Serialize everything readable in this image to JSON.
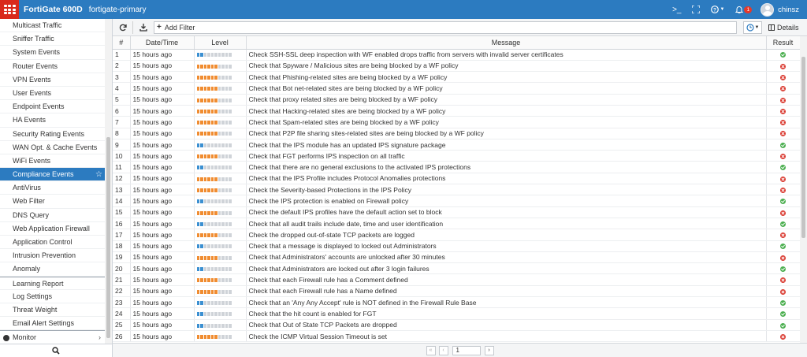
{
  "header": {
    "product": "FortiGate 600D",
    "hostname": "fortigate-primary",
    "cli_icon": ">_",
    "notification_count": "1",
    "username": "chinsz"
  },
  "sidebar": {
    "items": [
      {
        "label": "Multicast Traffic"
      },
      {
        "label": "Sniffer Traffic"
      },
      {
        "label": "System Events"
      },
      {
        "label": "Router Events"
      },
      {
        "label": "VPN Events"
      },
      {
        "label": "User Events"
      },
      {
        "label": "Endpoint Events"
      },
      {
        "label": "HA Events"
      },
      {
        "label": "Security Rating Events"
      },
      {
        "label": "WAN Opt. & Cache Events"
      },
      {
        "label": "WiFi Events"
      },
      {
        "label": "Compliance Events"
      },
      {
        "label": "AntiVirus"
      },
      {
        "label": "Web Filter"
      },
      {
        "label": "DNS Query"
      },
      {
        "label": "Web Application Firewall"
      },
      {
        "label": "Application Control"
      },
      {
        "label": "Intrusion Prevention"
      },
      {
        "label": "Anomaly"
      },
      {
        "label": "Learning Report"
      },
      {
        "label": "Log Settings"
      },
      {
        "label": "Threat Weight"
      },
      {
        "label": "Email Alert Settings"
      },
      {
        "label": "Monitor"
      }
    ],
    "active_index": 11
  },
  "toolbar": {
    "add_filter_label": "Add Filter",
    "details_label": "Details"
  },
  "table": {
    "columns": [
      "#",
      "Date/Time",
      "Level",
      "Message",
      "Result"
    ],
    "rows": [
      {
        "num": "1",
        "time": "15 hours ago",
        "level": 2,
        "msg": "Check SSH-SSL deep inspection with WF enabled drops traffic from servers with invalid server certificates",
        "result": "pass"
      },
      {
        "num": "2",
        "time": "15 hours ago",
        "level": 6,
        "msg": "Check that Spyware / Malicious sites are being blocked by a WF policy",
        "result": "fail"
      },
      {
        "num": "3",
        "time": "15 hours ago",
        "level": 6,
        "msg": "Check that Phishing-related sites are being blocked by a WF policy",
        "result": "fail"
      },
      {
        "num": "4",
        "time": "15 hours ago",
        "level": 6,
        "msg": "Check that Bot net-related sites are being blocked by a WF policy",
        "result": "fail"
      },
      {
        "num": "5",
        "time": "15 hours ago",
        "level": 6,
        "msg": "Check that proxy related sites are being blocked by a WF policy",
        "result": "fail"
      },
      {
        "num": "6",
        "time": "15 hours ago",
        "level": 6,
        "msg": "Check that Hacking-related sites are being blocked by a WF policy",
        "result": "fail"
      },
      {
        "num": "7",
        "time": "15 hours ago",
        "level": 6,
        "msg": "Check that Spam-related sites are being blocked by a WF policy",
        "result": "fail"
      },
      {
        "num": "8",
        "time": "15 hours ago",
        "level": 6,
        "msg": "Check that P2P file sharing sites-related sites are being blocked by a WF policy",
        "result": "fail"
      },
      {
        "num": "9",
        "time": "15 hours ago",
        "level": 2,
        "msg": "Check that the IPS module has an updated IPS signature package",
        "result": "pass"
      },
      {
        "num": "10",
        "time": "15 hours ago",
        "level": 6,
        "msg": "Check that FGT performs IPS inspection on all traffic",
        "result": "fail"
      },
      {
        "num": "11",
        "time": "15 hours ago",
        "level": 2,
        "msg": "Check that there are no general exclusions to the activated IPS protections",
        "result": "pass"
      },
      {
        "num": "12",
        "time": "15 hours ago",
        "level": 6,
        "msg": "Check that the IPS Profile includes Protocol Anomalies protections",
        "result": "fail"
      },
      {
        "num": "13",
        "time": "15 hours ago",
        "level": 6,
        "msg": "Check the Severity-based Protections in the IPS Policy",
        "result": "fail"
      },
      {
        "num": "14",
        "time": "15 hours ago",
        "level": 2,
        "msg": "Check the IPS protection is enabled on Firewall policy",
        "result": "pass"
      },
      {
        "num": "15",
        "time": "15 hours ago",
        "level": 6,
        "msg": "Check the default IPS profiles have the default action set to block",
        "result": "fail"
      },
      {
        "num": "16",
        "time": "15 hours ago",
        "level": 2,
        "msg": "Check that all audit trails include date, time and user identification",
        "result": "pass"
      },
      {
        "num": "17",
        "time": "15 hours ago",
        "level": 6,
        "msg": "Check the dropped out-of-state TCP packets are logged",
        "result": "fail"
      },
      {
        "num": "18",
        "time": "15 hours ago",
        "level": 2,
        "msg": "Check that a message is displayed to locked out Administrators",
        "result": "pass"
      },
      {
        "num": "19",
        "time": "15 hours ago",
        "level": 6,
        "msg": "Check that Administrators' accounts are unlocked after 30 minutes",
        "result": "fail"
      },
      {
        "num": "20",
        "time": "15 hours ago",
        "level": 2,
        "msg": "Check that Administrators are locked out after 3 login failures",
        "result": "pass"
      },
      {
        "num": "21",
        "time": "15 hours ago",
        "level": 6,
        "msg": "Check that each Firewall rule has a Comment defined",
        "result": "fail"
      },
      {
        "num": "22",
        "time": "15 hours ago",
        "level": 6,
        "msg": "Check that each Firewall rule has a Name defined",
        "result": "fail"
      },
      {
        "num": "23",
        "time": "15 hours ago",
        "level": 2,
        "msg": "Check that an 'Any Any Accept' rule is NOT defined in the Firewall Rule Base",
        "result": "pass"
      },
      {
        "num": "24",
        "time": "15 hours ago",
        "level": 2,
        "msg": "Check that the hit count is enabled for FGT",
        "result": "pass"
      },
      {
        "num": "25",
        "time": "15 hours ago",
        "level": 2,
        "msg": "Check that Out of State TCP Packets are dropped",
        "result": "pass"
      },
      {
        "num": "26",
        "time": "15 hours ago",
        "level": 6,
        "msg": "Check the ICMP Virtual Session Timeout is set",
        "result": "fail"
      }
    ]
  },
  "pager": {
    "current_page": "1",
    "first_icon": "«",
    "prev_icon": "‹",
    "next_icon": "›"
  },
  "colors": {
    "header_bg": "#2c7bc0",
    "logo_red": "#d9291c",
    "active_item": "#2c7bc0",
    "pass": "#4caf50",
    "fail": "#d9352b",
    "level_low": "#3a8fd1",
    "level_high": "#f08c30"
  }
}
